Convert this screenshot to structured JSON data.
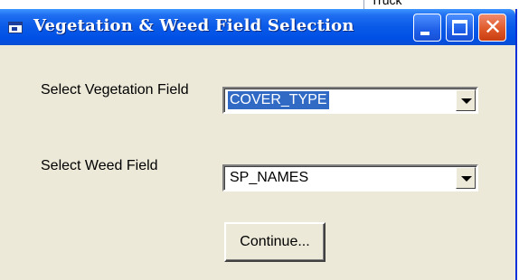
{
  "background": {
    "text": "Truck"
  },
  "window": {
    "title": "Vegetation & Weed Field Selection",
    "controls": {
      "minimize_icon": "minimize-icon",
      "maximize_icon": "maximize-icon",
      "close_icon": "close-icon",
      "close_glyph": "✕"
    }
  },
  "form": {
    "vegetation_label": "Select Vegetation Field",
    "vegetation_value": "COVER_TYPE",
    "weed_label": "Select Weed Field",
    "weed_value": "SP_NAMES",
    "continue_label": "Continue..."
  },
  "colors": {
    "titlebar": "#0a5ae8",
    "window_bg": "#ece9d8",
    "selection": "#316ac5",
    "close_button": "#e05a2a"
  }
}
